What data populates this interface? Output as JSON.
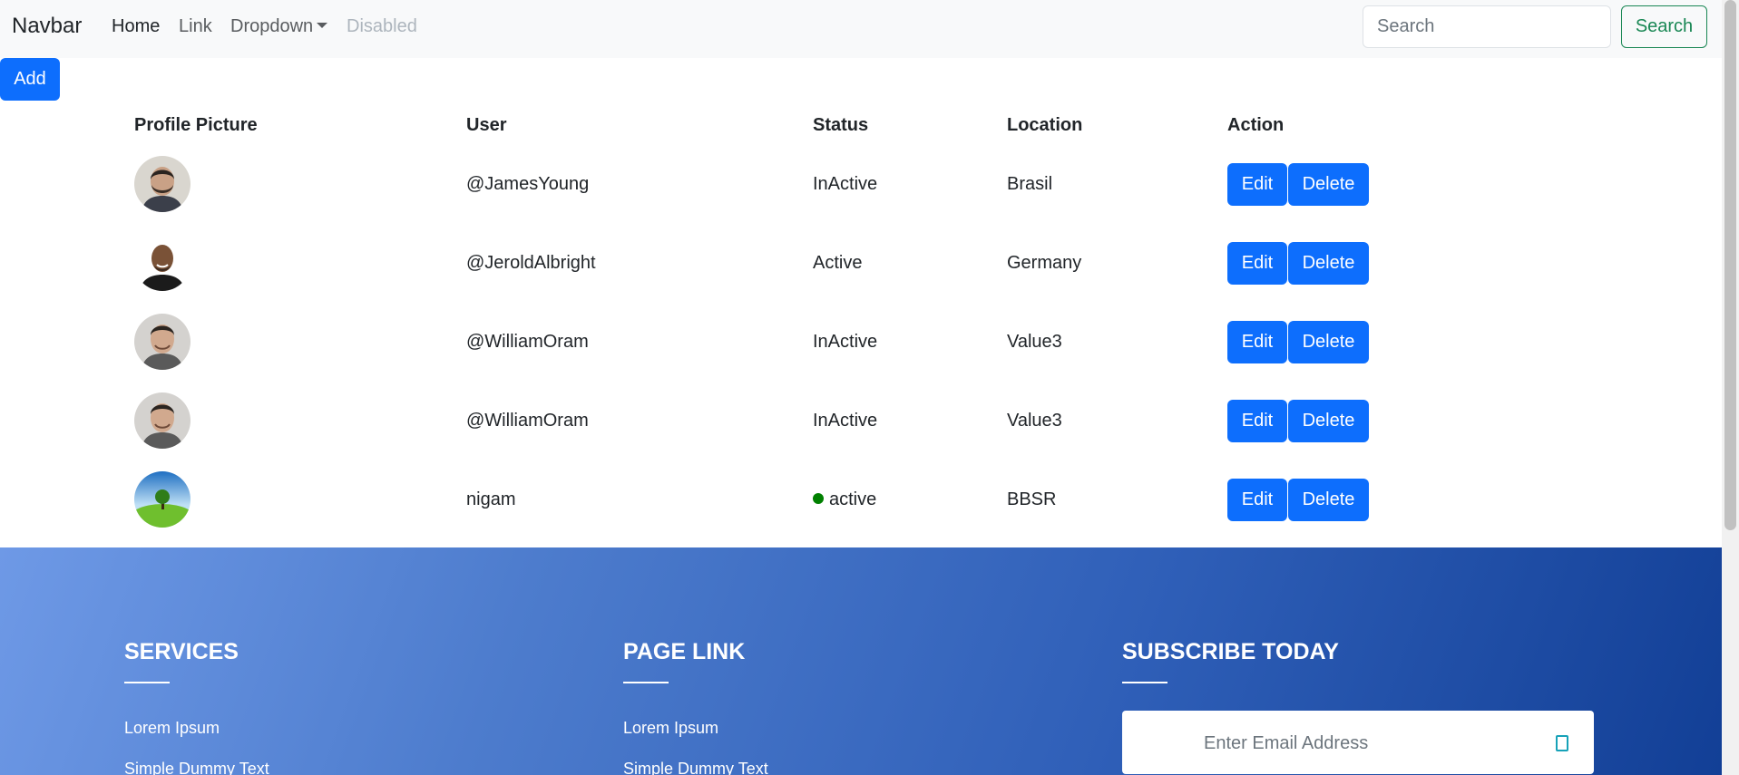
{
  "navbar": {
    "brand": "Navbar",
    "links": {
      "home": "Home",
      "link": "Link",
      "dropdown": "Dropdown",
      "disabled": "Disabled"
    },
    "search": {
      "placeholder": "Search",
      "button_label": "Search"
    }
  },
  "toolbar": {
    "add_label": "Add"
  },
  "table": {
    "headers": {
      "profile_picture": "Profile Picture",
      "user": "User",
      "status": "Status",
      "location": "Location",
      "action": "Action"
    },
    "rows": [
      {
        "user": "@JamesYoung",
        "status": "InActive",
        "location": "Brasil",
        "avatar": "man-beard-portrait",
        "edit_label": "Edit",
        "delete_label": "Delete"
      },
      {
        "user": "@JeroldAlbright",
        "status": "Active",
        "location": "Germany",
        "avatar": "man-bald-smiling-portrait",
        "edit_label": "Edit",
        "delete_label": "Delete"
      },
      {
        "user": "@WilliamOram",
        "status": "InActive",
        "location": "Value3",
        "avatar": "man-smiling-portrait",
        "edit_label": "Edit",
        "delete_label": "Delete"
      },
      {
        "user": "@WilliamOram",
        "status": "InActive",
        "location": "Value3",
        "avatar": "man-smiling-portrait",
        "edit_label": "Edit",
        "delete_label": "Delete"
      },
      {
        "user": "nigam",
        "status": "active",
        "status_dot_color": "#008000",
        "location": "BBSR",
        "avatar": "tree-landscape",
        "edit_label": "Edit",
        "delete_label": "Delete"
      }
    ]
  },
  "footer": {
    "services": {
      "heading": "SERVICES",
      "links": [
        "Lorem Ipsum",
        "Simple Dummy Text"
      ]
    },
    "page_link": {
      "heading": "PAGE LINK",
      "links": [
        "Lorem Ipsum",
        "Simple Dummy Text"
      ]
    },
    "subscribe": {
      "heading": "SUBSCRIBE TODAY",
      "email_placeholder": "Enter Email Address",
      "send_icon": "send-icon"
    }
  },
  "colors": {
    "primary": "#0d6efd",
    "success": "#198754",
    "navbar_bg": "#f8f9fa",
    "footer_gradient_start": "#6e99e6",
    "footer_gradient_end": "#123f96"
  }
}
